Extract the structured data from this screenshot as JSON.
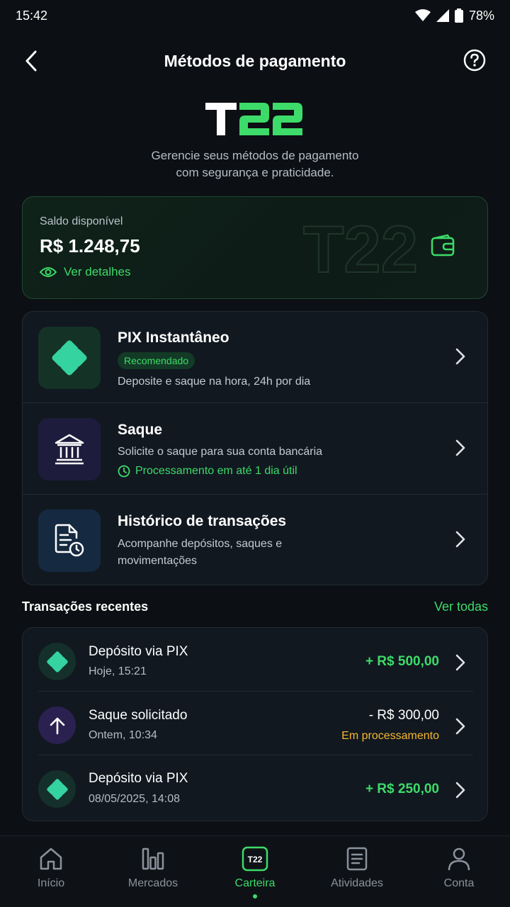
{
  "status_bar": {
    "time": "15:42",
    "battery": "78%"
  },
  "header": {
    "title": "Métodos de pagamento"
  },
  "logo": {
    "text_white": "T",
    "text_green": "22"
  },
  "subtitle": {
    "line1": "Gerencie seus métodos de pagamento",
    "line2": "com segurança e praticidade."
  },
  "balance": {
    "label": "Saldo disponível",
    "value": "R$ 1.248,75",
    "details_link": "Ver detalhes",
    "watermark": "T22"
  },
  "methods": [
    {
      "title": "PIX Instantâneo",
      "badge": "Recomendado",
      "description": "Deposite e saque na hora, 24h por dia",
      "icon": "pix-icon"
    },
    {
      "title": "Saque",
      "description": "Solicite o saque para sua conta bancária",
      "note": "Processamento em até 1 dia útil",
      "icon": "bank-icon"
    },
    {
      "title": "Histórico de transações",
      "description_line1": "Acompanhe depósitos, saques e",
      "description_line2": "movimentações",
      "icon": "document-clock-icon"
    }
  ],
  "recent": {
    "title": "Transações recentes",
    "see_all": "Ver todas",
    "transactions": [
      {
        "title": "Depósito via PIX",
        "date": "Hoje, 15:21",
        "amount": "+ R$ 500,00",
        "status": "",
        "type": "deposit"
      },
      {
        "title": "Saque solicitado",
        "date": "Ontem, 10:34",
        "amount": "- R$ 300,00",
        "status": "Em processamento",
        "type": "withdraw"
      },
      {
        "title": "Depósito via PIX",
        "date": "08/05/2025, 14:08",
        "amount": "+ R$ 250,00",
        "status": "",
        "type": "deposit"
      }
    ]
  },
  "nav": [
    {
      "label": "Início",
      "icon": "home-icon"
    },
    {
      "label": "Mercados",
      "icon": "bar-chart-icon"
    },
    {
      "label": "Carteira",
      "icon": "wallet-logo-icon",
      "active": true
    },
    {
      "label": "Atividades",
      "icon": "list-icon"
    },
    {
      "label": "Conta",
      "icon": "user-icon"
    }
  ],
  "colors": {
    "accent": "#3ddb69",
    "warning": "#f5b82e",
    "background": "#0c0f13",
    "card": "#111820"
  }
}
